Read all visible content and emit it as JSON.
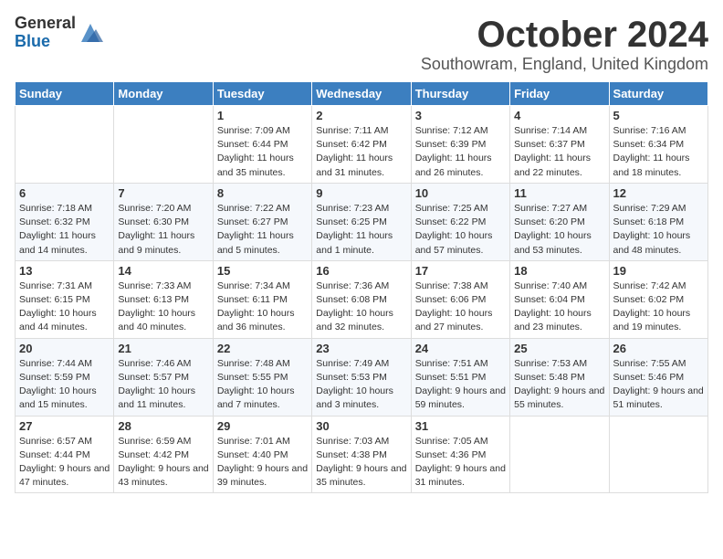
{
  "header": {
    "logo_general": "General",
    "logo_blue": "Blue",
    "month_title": "October 2024",
    "location": "Southowram, England, United Kingdom"
  },
  "days_of_week": [
    "Sunday",
    "Monday",
    "Tuesday",
    "Wednesday",
    "Thursday",
    "Friday",
    "Saturday"
  ],
  "weeks": [
    [
      {
        "day": "",
        "info": ""
      },
      {
        "day": "",
        "info": ""
      },
      {
        "day": "1",
        "info": "Sunrise: 7:09 AM\nSunset: 6:44 PM\nDaylight: 11 hours and 35 minutes."
      },
      {
        "day": "2",
        "info": "Sunrise: 7:11 AM\nSunset: 6:42 PM\nDaylight: 11 hours and 31 minutes."
      },
      {
        "day": "3",
        "info": "Sunrise: 7:12 AM\nSunset: 6:39 PM\nDaylight: 11 hours and 26 minutes."
      },
      {
        "day": "4",
        "info": "Sunrise: 7:14 AM\nSunset: 6:37 PM\nDaylight: 11 hours and 22 minutes."
      },
      {
        "day": "5",
        "info": "Sunrise: 7:16 AM\nSunset: 6:34 PM\nDaylight: 11 hours and 18 minutes."
      }
    ],
    [
      {
        "day": "6",
        "info": "Sunrise: 7:18 AM\nSunset: 6:32 PM\nDaylight: 11 hours and 14 minutes."
      },
      {
        "day": "7",
        "info": "Sunrise: 7:20 AM\nSunset: 6:30 PM\nDaylight: 11 hours and 9 minutes."
      },
      {
        "day": "8",
        "info": "Sunrise: 7:22 AM\nSunset: 6:27 PM\nDaylight: 11 hours and 5 minutes."
      },
      {
        "day": "9",
        "info": "Sunrise: 7:23 AM\nSunset: 6:25 PM\nDaylight: 11 hours and 1 minute."
      },
      {
        "day": "10",
        "info": "Sunrise: 7:25 AM\nSunset: 6:22 PM\nDaylight: 10 hours and 57 minutes."
      },
      {
        "day": "11",
        "info": "Sunrise: 7:27 AM\nSunset: 6:20 PM\nDaylight: 10 hours and 53 minutes."
      },
      {
        "day": "12",
        "info": "Sunrise: 7:29 AM\nSunset: 6:18 PM\nDaylight: 10 hours and 48 minutes."
      }
    ],
    [
      {
        "day": "13",
        "info": "Sunrise: 7:31 AM\nSunset: 6:15 PM\nDaylight: 10 hours and 44 minutes."
      },
      {
        "day": "14",
        "info": "Sunrise: 7:33 AM\nSunset: 6:13 PM\nDaylight: 10 hours and 40 minutes."
      },
      {
        "day": "15",
        "info": "Sunrise: 7:34 AM\nSunset: 6:11 PM\nDaylight: 10 hours and 36 minutes."
      },
      {
        "day": "16",
        "info": "Sunrise: 7:36 AM\nSunset: 6:08 PM\nDaylight: 10 hours and 32 minutes."
      },
      {
        "day": "17",
        "info": "Sunrise: 7:38 AM\nSunset: 6:06 PM\nDaylight: 10 hours and 27 minutes."
      },
      {
        "day": "18",
        "info": "Sunrise: 7:40 AM\nSunset: 6:04 PM\nDaylight: 10 hours and 23 minutes."
      },
      {
        "day": "19",
        "info": "Sunrise: 7:42 AM\nSunset: 6:02 PM\nDaylight: 10 hours and 19 minutes."
      }
    ],
    [
      {
        "day": "20",
        "info": "Sunrise: 7:44 AM\nSunset: 5:59 PM\nDaylight: 10 hours and 15 minutes."
      },
      {
        "day": "21",
        "info": "Sunrise: 7:46 AM\nSunset: 5:57 PM\nDaylight: 10 hours and 11 minutes."
      },
      {
        "day": "22",
        "info": "Sunrise: 7:48 AM\nSunset: 5:55 PM\nDaylight: 10 hours and 7 minutes."
      },
      {
        "day": "23",
        "info": "Sunrise: 7:49 AM\nSunset: 5:53 PM\nDaylight: 10 hours and 3 minutes."
      },
      {
        "day": "24",
        "info": "Sunrise: 7:51 AM\nSunset: 5:51 PM\nDaylight: 9 hours and 59 minutes."
      },
      {
        "day": "25",
        "info": "Sunrise: 7:53 AM\nSunset: 5:48 PM\nDaylight: 9 hours and 55 minutes."
      },
      {
        "day": "26",
        "info": "Sunrise: 7:55 AM\nSunset: 5:46 PM\nDaylight: 9 hours and 51 minutes."
      }
    ],
    [
      {
        "day": "27",
        "info": "Sunrise: 6:57 AM\nSunset: 4:44 PM\nDaylight: 9 hours and 47 minutes."
      },
      {
        "day": "28",
        "info": "Sunrise: 6:59 AM\nSunset: 4:42 PM\nDaylight: 9 hours and 43 minutes."
      },
      {
        "day": "29",
        "info": "Sunrise: 7:01 AM\nSunset: 4:40 PM\nDaylight: 9 hours and 39 minutes."
      },
      {
        "day": "30",
        "info": "Sunrise: 7:03 AM\nSunset: 4:38 PM\nDaylight: 9 hours and 35 minutes."
      },
      {
        "day": "31",
        "info": "Sunrise: 7:05 AM\nSunset: 4:36 PM\nDaylight: 9 hours and 31 minutes."
      },
      {
        "day": "",
        "info": ""
      },
      {
        "day": "",
        "info": ""
      }
    ]
  ]
}
